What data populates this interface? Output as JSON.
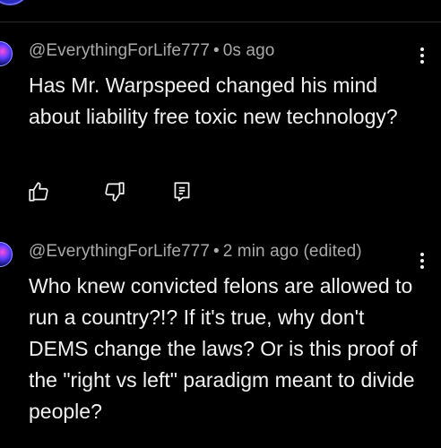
{
  "comments": [
    {
      "author": "@EverythingForLife777",
      "separator": "•",
      "time": "0s ago",
      "text": "Has Mr. Warpspeed changed his mind about liability free toxic new technology?",
      "icons": {
        "like": "thumbs-up-icon",
        "dislike": "thumbs-down-icon",
        "reply": "reply-icon"
      }
    },
    {
      "author": "@EverythingForLife777",
      "separator": "•",
      "time": "2 min ago (edited)",
      "text": "Who knew convicted felons are allowed to run a country?!?  If it's true, why don't DEMS change the laws?  Or is this proof of the \"right vs left\" paradigm meant to divide people?"
    }
  ],
  "colors": {
    "background": "#000000",
    "text": "#f1f1f1",
    "meta": "#aaaaaa"
  }
}
